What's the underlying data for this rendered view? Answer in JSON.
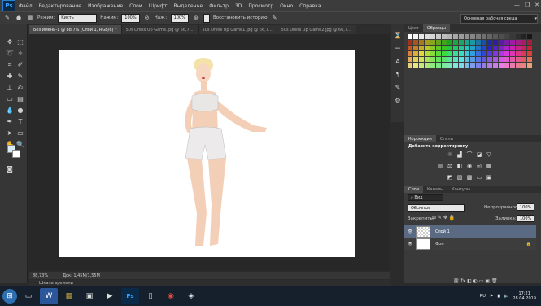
{
  "app": {
    "logo": "Ps"
  },
  "menu": [
    "Файл",
    "Редактирование",
    "Изображение",
    "Слои",
    "Шрифт",
    "Выделение",
    "Фильтр",
    "3D",
    "Просмотр",
    "Окно",
    "Справка"
  ],
  "window_controls": [
    "—",
    "❐",
    "✕"
  ],
  "options": {
    "mode_label": "Режим:",
    "mode_value": "Кисть",
    "pressure_label": "Нажим:",
    "opacity_label": "Непрозр.:",
    "opacity_value": "100%",
    "flow_label": "Наж.:",
    "flow_value": "100%",
    "history_label": "Восстановить историю",
    "workspace": "Основная рабочая среда"
  },
  "tabs": [
    "Без имени-1 @ 88,7% (Слой 1, RGB/8) *",
    "50s Dress Up Game.jpg @ 66,7...",
    "50s Dress Up Game1.jpg @ 66,7...",
    "50s Dress Up Game2.jpg @ 66,7..."
  ],
  "status": {
    "zoom": "88,73%",
    "doc": "Док: 1,45M/1,55M"
  },
  "timeline": "Шкала времени",
  "swatches_panel": {
    "tabs": [
      "Цвет",
      "Образцы"
    ],
    "active": 1
  },
  "adjustments_panel": {
    "tabs": [
      "Коррекция",
      "Стили"
    ],
    "title": "Добавить корректировку"
  },
  "layers_panel": {
    "tabs": [
      "Слои",
      "Каналы",
      "Контуры"
    ],
    "kind": "Вид",
    "blend_mode": "Обычные",
    "opacity_label": "Непрозрачность:",
    "opacity_value": "100%",
    "lock_label": "Закрепить:",
    "fill_label": "Заливка:",
    "fill_value": "100%",
    "layers": [
      {
        "name": "Слой 1",
        "selected": true
      },
      {
        "name": "Фон",
        "selected": false
      }
    ]
  },
  "taskbar": {
    "lang": "RU",
    "time": "17:21",
    "date": "28.04.2019"
  },
  "colors": {
    "accent": "#1c8cf0",
    "canvas_bg": "#282828",
    "panel": "#3a3a3a"
  }
}
